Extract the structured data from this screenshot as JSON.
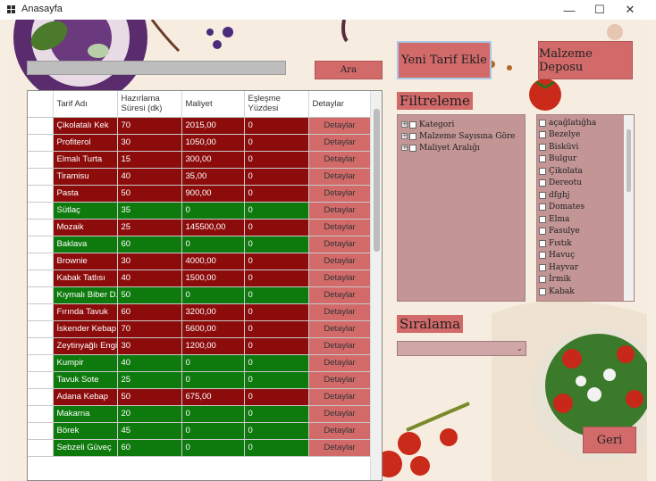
{
  "window": {
    "title": "Anasayfa",
    "icon": "app-grid-icon",
    "controls": [
      "—",
      "☐",
      "✕"
    ]
  },
  "search": {
    "value": "",
    "button_label": "Ara"
  },
  "actions": {
    "new_recipe": "Yeni Tarif Ekle",
    "ingredient_depot": "Malzeme Deposu",
    "back": "Geri"
  },
  "table": {
    "columns": [
      "Tarif Adı",
      "Hazırlama Süresi (dk)",
      "Maliyet",
      "Eşleşme Yüzdesi",
      "Detaylar"
    ],
    "rows": [
      {
        "name": "Çikolatalı Kek",
        "time": "70",
        "cost": "2015,00",
        "match": "0",
        "detail": "Detaylar",
        "status": "red"
      },
      {
        "name": "Profiterol",
        "time": "30",
        "cost": "1050,00",
        "match": "0",
        "detail": "Detaylar",
        "status": "red"
      },
      {
        "name": "Elmalı Turta",
        "time": "15",
        "cost": "300,00",
        "match": "0",
        "detail": "Detaylar",
        "status": "red"
      },
      {
        "name": "Tiramisu",
        "time": "40",
        "cost": "35,00",
        "match": "0",
        "detail": "Detaylar",
        "status": "red"
      },
      {
        "name": "Pasta",
        "time": "50",
        "cost": "900,00",
        "match": "0",
        "detail": "Detaylar",
        "status": "red"
      },
      {
        "name": "Sütlaç",
        "time": "35",
        "cost": "0",
        "match": "0",
        "detail": "Detaylar",
        "status": "green"
      },
      {
        "name": "Mozaik",
        "time": "25",
        "cost": "145500,00",
        "match": "0",
        "detail": "Detaylar",
        "status": "red"
      },
      {
        "name": "Baklava",
        "time": "60",
        "cost": "0",
        "match": "0",
        "detail": "Detaylar",
        "status": "green"
      },
      {
        "name": "Brownie",
        "time": "30",
        "cost": "4000,00",
        "match": "0",
        "detail": "Detaylar",
        "status": "red"
      },
      {
        "name": "Kabak Tatlısı",
        "time": "40",
        "cost": "1500,00",
        "match": "0",
        "detail": "Detaylar",
        "status": "red"
      },
      {
        "name": "Kıymalı Biber D...",
        "time": "50",
        "cost": "0",
        "match": "0",
        "detail": "Detaylar",
        "status": "green"
      },
      {
        "name": "Fırında Tavuk",
        "time": "60",
        "cost": "3200,00",
        "match": "0",
        "detail": "Detaylar",
        "status": "red"
      },
      {
        "name": "İskender Kebap",
        "time": "70",
        "cost": "5600,00",
        "match": "0",
        "detail": "Detaylar",
        "status": "red"
      },
      {
        "name": "Zeytinyağlı Engi...",
        "time": "30",
        "cost": "1200,00",
        "match": "0",
        "detail": "Detaylar",
        "status": "red"
      },
      {
        "name": "Kumpir",
        "time": "40",
        "cost": "0",
        "match": "0",
        "detail": "Detaylar",
        "status": "green"
      },
      {
        "name": "Tavuk Sote",
        "time": "25",
        "cost": "0",
        "match": "0",
        "detail": "Detaylar",
        "status": "green"
      },
      {
        "name": "Adana Kebap",
        "time": "50",
        "cost": "675,00",
        "match": "0",
        "detail": "Detaylar",
        "status": "red"
      },
      {
        "name": "Makarna",
        "time": "20",
        "cost": "0",
        "match": "0",
        "detail": "Detaylar",
        "status": "green"
      },
      {
        "name": "Börek",
        "time": "45",
        "cost": "0",
        "match": "0",
        "detail": "Detaylar",
        "status": "green"
      },
      {
        "name": "Sebzeli Güveç",
        "time": "60",
        "cost": "0",
        "match": "0",
        "detail": "Detaylar",
        "status": "green"
      }
    ]
  },
  "filter": {
    "title": "Filtreleme",
    "items": [
      "Kategori",
      "Malzeme Sayısına Göre",
      "Maliyet Aralığı"
    ]
  },
  "ingredients": {
    "items": [
      "açağlatığha",
      "Bezelye",
      "Bisküvi",
      "Bulgur",
      "Çikolata",
      "Dereotu",
      "dfghj",
      "Domates",
      "Elma",
      "Fasulye",
      "Fıstık",
      "Havuç",
      "Hayvar",
      "İrmik",
      "Kabak"
    ]
  },
  "sort": {
    "title": "Sıralama",
    "selected": ""
  },
  "colors": {
    "accent": "#d26a6a",
    "row_red": "#8c0c0c",
    "row_green": "#0e7a0e",
    "background": "#f6ede0"
  }
}
